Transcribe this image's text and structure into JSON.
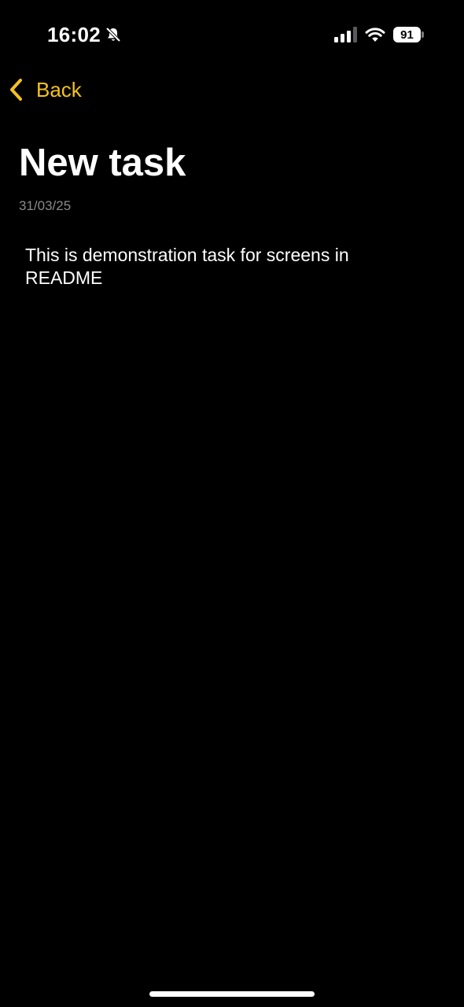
{
  "status_bar": {
    "time": "16:02",
    "battery_level": "91",
    "icons": [
      "bell-slash-icon",
      "cellular-signal-icon",
      "wifi-icon",
      "battery-icon"
    ]
  },
  "nav": {
    "back_label": "Back",
    "back_icon": "chevron-left-icon"
  },
  "task": {
    "title": "New task",
    "date": "31/03/25",
    "description": "This is demonstration task for screens in README"
  },
  "colors": {
    "background": "#000000",
    "accent": "#f4c21f",
    "text_primary": "#ffffff",
    "text_secondary": "#8a8a8e"
  }
}
